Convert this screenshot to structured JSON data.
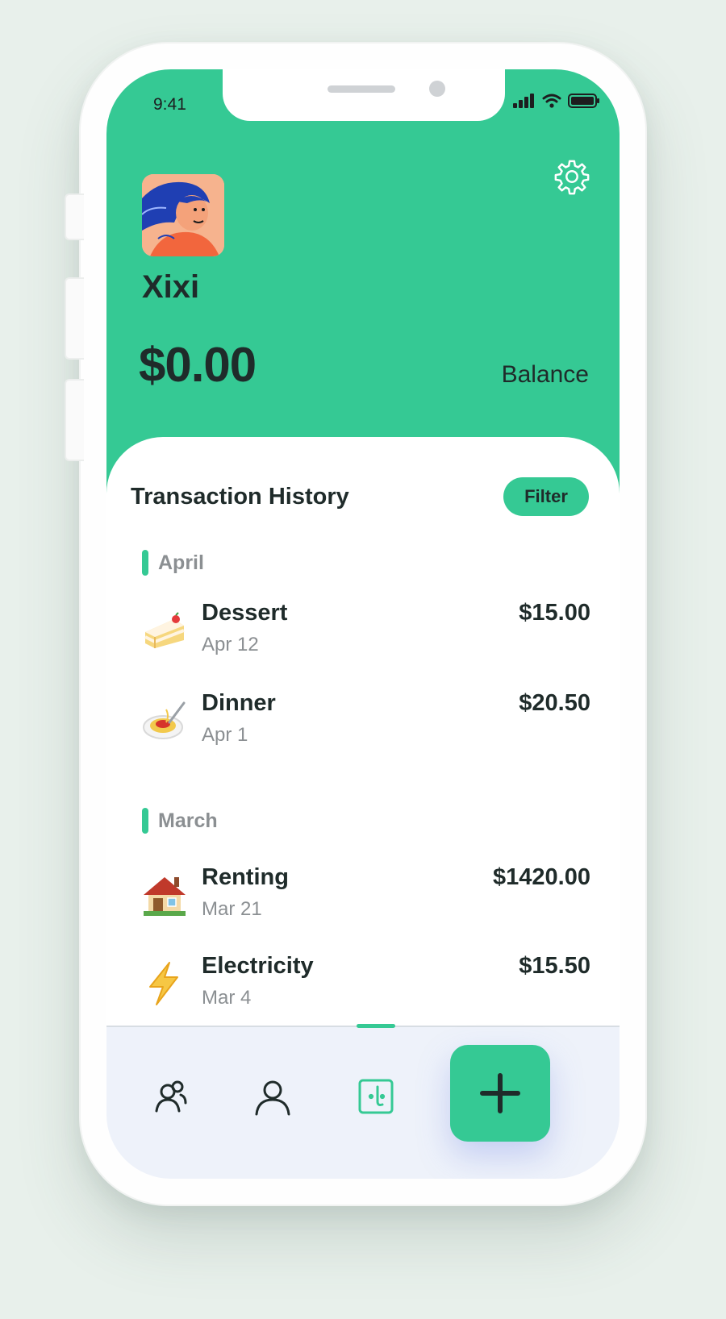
{
  "status_bar": {
    "time": "9:41"
  },
  "profile": {
    "name": "Xixi",
    "balance_amount": "$0.00",
    "balance_label": "Balance"
  },
  "history": {
    "title": "Transaction History",
    "filter_label": "Filter",
    "groups": [
      {
        "month": "April",
        "items": [
          {
            "icon": "cake-icon",
            "title": "Dessert",
            "date": "Apr 12",
            "amount": "$15.00"
          },
          {
            "icon": "spaghetti-icon",
            "title": "Dinner",
            "date": "Apr 1",
            "amount": "$20.50"
          }
        ]
      },
      {
        "month": "March",
        "items": [
          {
            "icon": "house-icon",
            "title": "Renting",
            "date": "Mar 21",
            "amount": "$1420.00"
          },
          {
            "icon": "lightning-icon",
            "title": "Electricity",
            "date": "Mar 4",
            "amount": "$15.50"
          }
        ]
      }
    ]
  },
  "tabbar": {
    "tabs": [
      {
        "icon": "group-users-icon"
      },
      {
        "icon": "user-icon"
      },
      {
        "icon": "ledger-icon",
        "active": true
      }
    ],
    "add_icon": "plus-icon"
  },
  "colors": {
    "accent": "#35c994",
    "text": "#1f2b2a",
    "muted": "#8b8f92",
    "tabbar_bg": "#eef2fa"
  }
}
